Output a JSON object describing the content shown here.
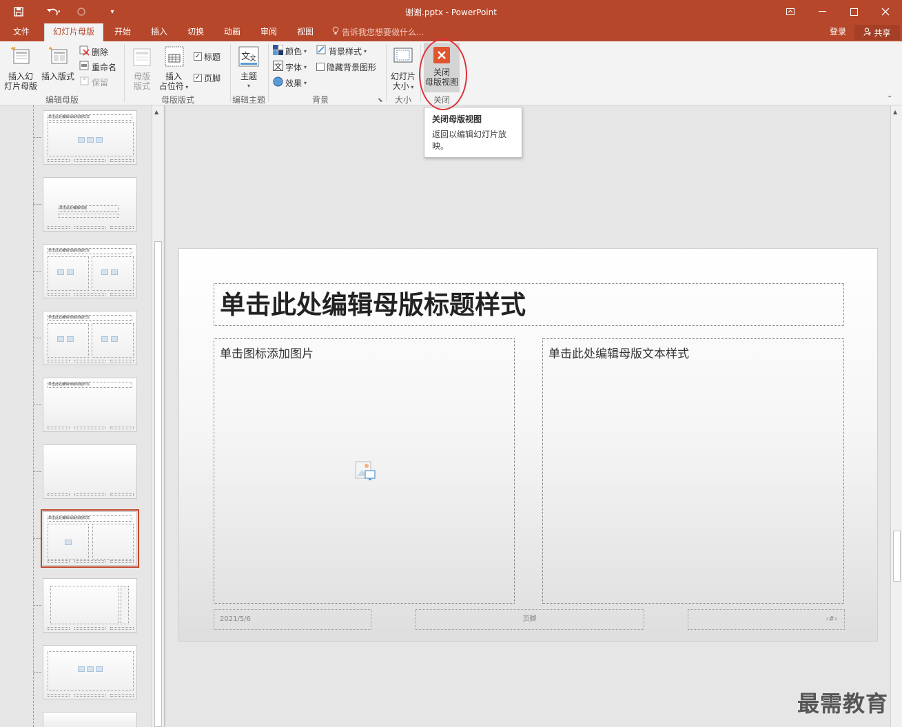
{
  "window": {
    "title": "谢谢.pptx - PowerPoint",
    "save_icon": "save-icon",
    "undo_icon": "undo-icon",
    "redo_icon": "redo-icon"
  },
  "tabs": [
    "文件",
    "幻灯片母版",
    "开始",
    "插入",
    "切换",
    "动画",
    "审阅",
    "视图"
  ],
  "tell_me": "告诉我您想要做什么...",
  "account": {
    "login": "登录",
    "share": "共享"
  },
  "ribbon": {
    "insert_master": "插入幻\n灯片母版",
    "insert_layout": "插入版式",
    "delete": "删除",
    "rename": "重命名",
    "preserve": "保留",
    "group_edit_master": "编辑母版",
    "master_layout": "母版\n版式",
    "insert_placeholder": "插入\n占位符",
    "title_check": "标题",
    "footer_check": "页脚",
    "group_master_layout": "母版版式",
    "themes": "主题",
    "group_edit_theme": "编辑主题",
    "colors": "颜色",
    "fonts": "字体",
    "effects": "效果",
    "bg_styles": "背景样式",
    "hide_bg": "隐藏背景图形",
    "group_background": "背景",
    "slide_size": "幻灯片\n大小",
    "group_size": "大小",
    "close_master": "关闭\n母版视图",
    "group_close": "关闭"
  },
  "tooltip": {
    "title": "关闭母版视图",
    "desc": "返回以编辑幻灯片放映。"
  },
  "thumbnails": {
    "title_text": "单击此处编辑母版标题样式",
    "section_text": "单击此处编辑标题",
    "selected_index": 6
  },
  "slide": {
    "title": "单击此处编辑母版标题样式",
    "left_placeholder": "单击图标添加图片",
    "right_placeholder": "单击此处编辑母版文本样式",
    "date": "2021/5/6",
    "footer": "页脚",
    "number": "‹#›"
  },
  "watermark": "最需教育",
  "colors": {
    "accent": "#b7472a",
    "close_button": "#e0542f"
  }
}
